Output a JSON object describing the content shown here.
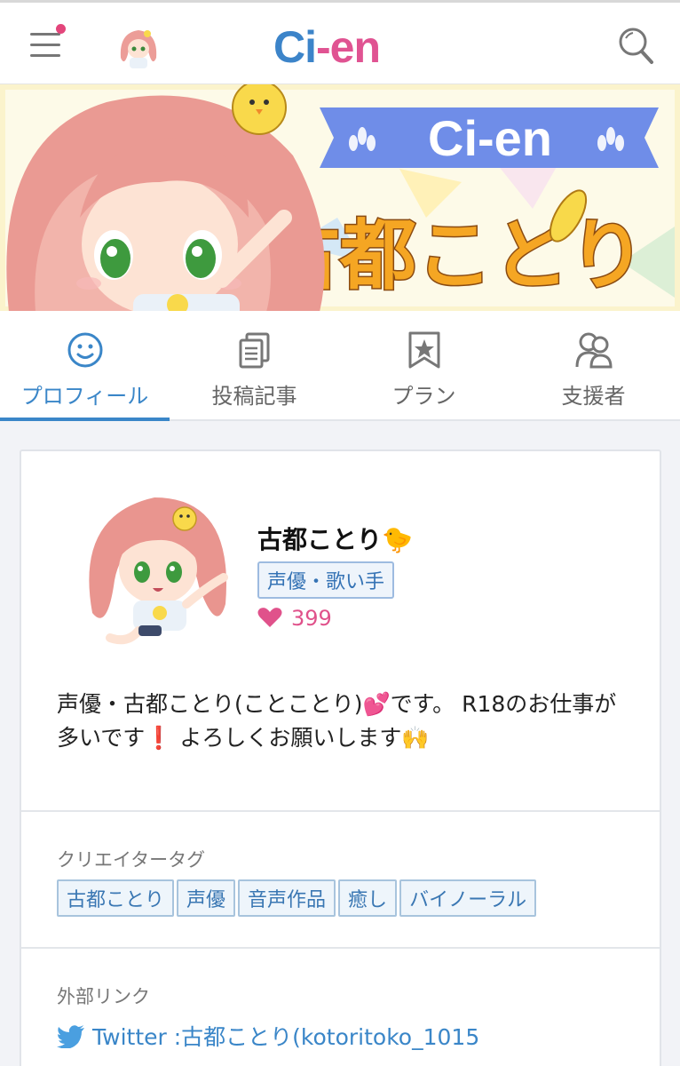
{
  "header": {
    "logo_left": "Ci",
    "logo_dash": "-",
    "logo_right": "en",
    "menu_icon": "hamburger-menu-icon",
    "search_icon": "search-icon",
    "notification_color": "#e3457b"
  },
  "banner": {
    "ribbon_text": "Ci-en",
    "title_text": "古都ことり"
  },
  "tabs": [
    {
      "label": "プロフィール",
      "icon": "smiley-face-icon",
      "active": true
    },
    {
      "label": "投稿記事",
      "icon": "documents-icon",
      "active": false
    },
    {
      "label": "プラン",
      "icon": "bookmark-star-icon",
      "active": false
    },
    {
      "label": "支援者",
      "icon": "supporters-icon",
      "active": false
    }
  ],
  "profile": {
    "name": "古都ことり🐤",
    "role": "声優・歌い手",
    "likes": "399",
    "bio": "声優・古都ことり(ことことり)💕です。 R18のお仕事が多いです❗️ よろしくお願いします🙌"
  },
  "creator_tags": {
    "title": "クリエイタータグ",
    "items": [
      "古都ことり",
      "声優",
      "音声作品",
      "癒し",
      "バイノーラル"
    ]
  },
  "external_links": {
    "title": "外部リンク",
    "twitter": "Twitter :古都ことり(kotoritoko_1015"
  },
  "colors": {
    "accent": "#3a86c8",
    "brand_pink": "#e05392",
    "heart": "#e0528b"
  }
}
